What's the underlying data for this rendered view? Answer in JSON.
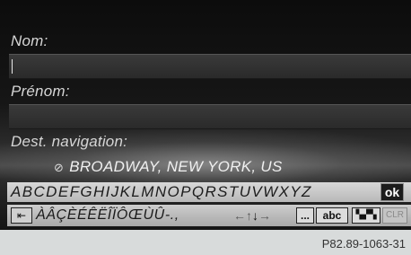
{
  "form": {
    "name_label": "Nom:",
    "name_value": "",
    "firstname_label": "Prénom:",
    "firstname_value": "",
    "dest_label": "Dest. navigation:",
    "dest_icon": "crosshair-icon",
    "dest_value": "BROADWAY, NEW YORK, US"
  },
  "keyboard": {
    "row1_letters": "ABCDEFGHIJKLMNOPQRSTUVWXYZ",
    "ok_label": "ok",
    "back_icon": "backspace-icon",
    "row2_accents": "ÀÂÇÈÉÊËÎÏÔŒÙÛ-.,",
    "arrows": "←↑",
    "arrow_down": "↓",
    "arrow_right": "→",
    "more_label": "...",
    "abc_label": "abc",
    "format_icon": "keyboard-format-icon",
    "clr_label": "CLR"
  },
  "caption": "P82.89-1063-31"
}
